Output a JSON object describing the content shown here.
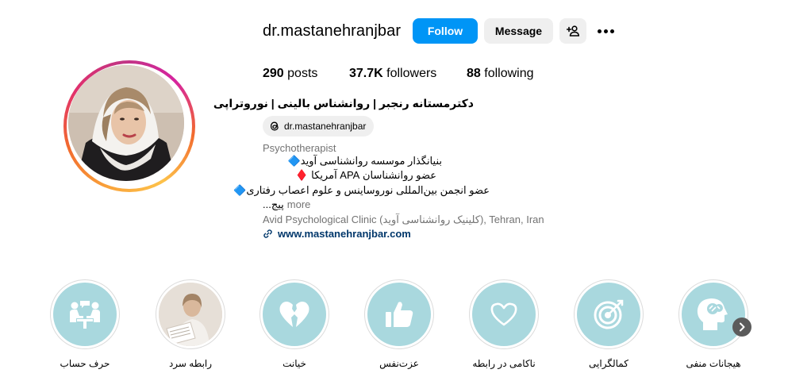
{
  "profile": {
    "username": "dr.mastanehranjbar",
    "follow_label": "Follow",
    "message_label": "Message",
    "stats": {
      "posts_count": "290",
      "posts_label": "posts",
      "followers_count": "37.7K",
      "followers_label": "followers",
      "following_count": "88",
      "following_label": "following"
    },
    "full_name": "دکترمستانه رنجبر | روانشناس بالینی | نوروتراپی",
    "threads_handle": "dr.mastanehranjbar",
    "category": "Psychotherapist",
    "bio_lines": [
      "بنیانگذار موسسه روانشناسی آوید🔷",
      "عضو روانشناسان APA آمریکا ♦️",
      "عضو انجمن بین‌المللی نوروساینس و علوم اعصاب رفتاری🔷"
    ],
    "bio_truncated": "...پیج",
    "more_label": "more",
    "address": "Avid Psychological Clinic (کلینیک روانشناسی آوید), Tehran, Iran",
    "website": "www.mastanehranjbar.com"
  },
  "highlights": [
    {
      "label": "حرف حساب",
      "icon": "people-talking-icon"
    },
    {
      "label": "رابطه سرد",
      "icon": "photo"
    },
    {
      "label": "خیانت",
      "icon": "broken-heart-icon"
    },
    {
      "label": "عزت‌نفس",
      "icon": "thumbs-up-icon"
    },
    {
      "label": "ناکامی در رابطه",
      "icon": "heart-outline-icon"
    },
    {
      "label": "کمالگرایی",
      "icon": "target-icon"
    },
    {
      "label": "هیجانات منفی",
      "icon": "head-brain-icon"
    }
  ],
  "colors": {
    "follow_button": "#0095f6",
    "secondary_button": "#efefef",
    "highlight_bg": "#a9d8de",
    "link": "#00376b",
    "muted_text": "#737373"
  }
}
